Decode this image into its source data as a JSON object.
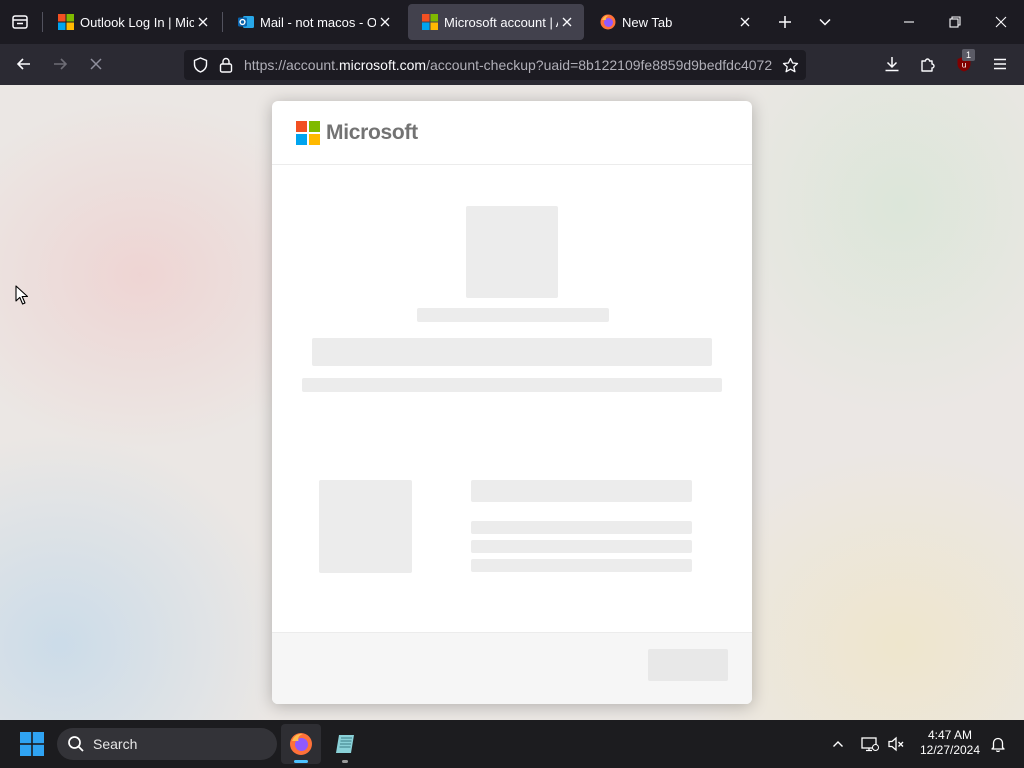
{
  "tabs": [
    {
      "title": "Outlook Log In | Microsoft",
      "favicon": "microsoft-favicon",
      "active": false
    },
    {
      "title": "Mail - not macos - Outlook",
      "favicon": "outlook-favicon",
      "active": false
    },
    {
      "title": "Microsoft account | Account",
      "favicon": "microsoft-favicon",
      "active": true
    },
    {
      "title": "New Tab",
      "favicon": "firefox-favicon",
      "active": false
    }
  ],
  "urlbar": {
    "prefix": "https://account.",
    "domain": "microsoft.com",
    "path": "/account-checkup?uaid=8b122109fe8859d9bedfdc4072"
  },
  "extension_badge": "1",
  "page": {
    "brand": "Microsoft",
    "loading": true
  },
  "taskbar": {
    "search_label": "Search",
    "time": "4:47 AM",
    "date": "12/27/2024"
  },
  "colors": {
    "ms_red": "#f25022",
    "ms_green": "#7fba00",
    "ms_blue": "#00a4ef",
    "ms_yellow": "#ffb900",
    "tab_active": "#42414d",
    "toolbar": "#2b2a33"
  }
}
